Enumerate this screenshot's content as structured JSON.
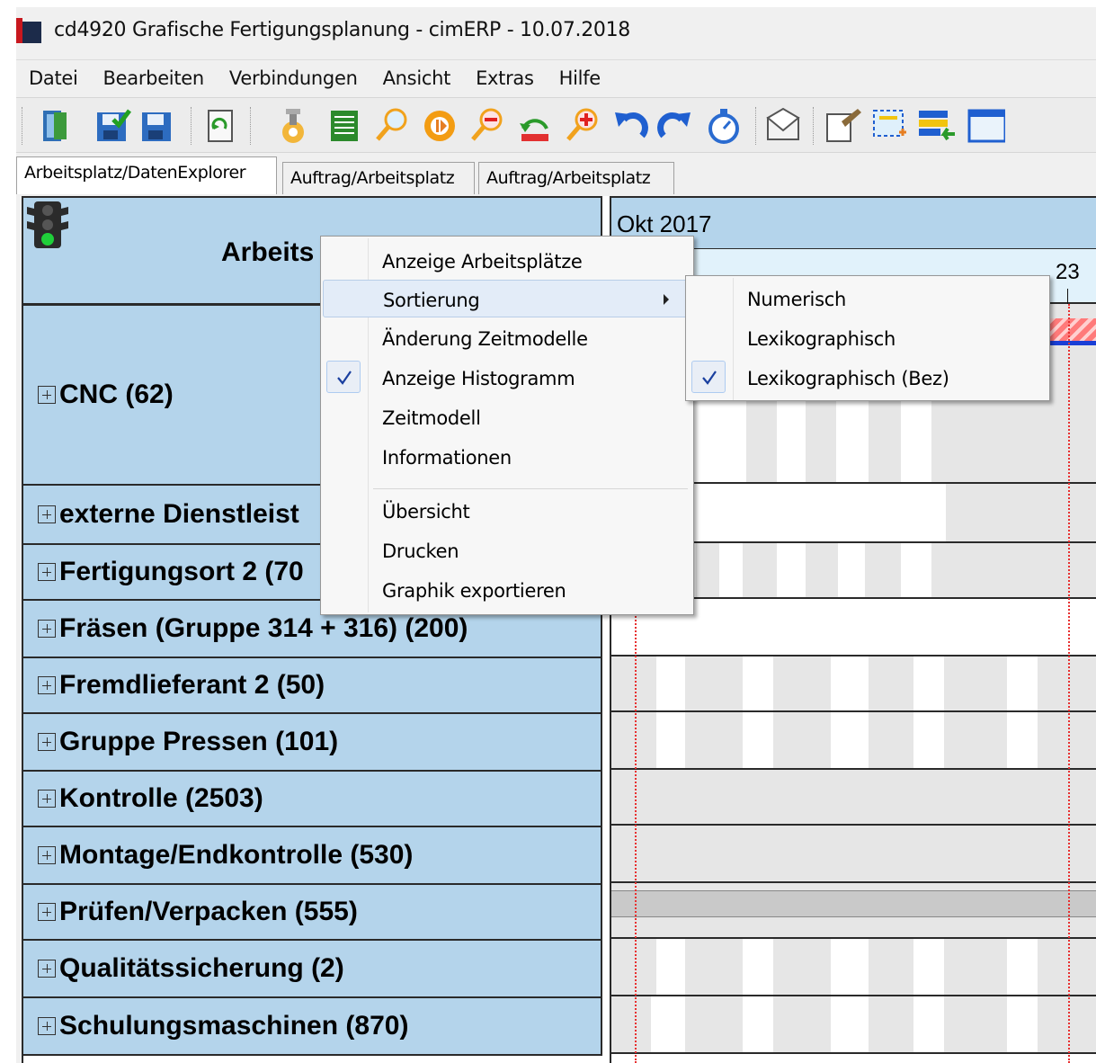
{
  "window": {
    "title": "cd4920 Grafische Fertigungsplanung - cimERP - 10.07.2018"
  },
  "menubar": [
    "Datei",
    "Bearbeiten",
    "Verbindungen",
    "Ansicht",
    "Extras",
    "Hilfe"
  ],
  "toolbar": {
    "icons": [
      "exit-icon",
      "save-green-icon",
      "save-icon",
      "refresh-icon",
      "settings-icon",
      "list-icon",
      "search-icon",
      "stop-icon",
      "zoom-out-icon",
      "undo-layout-icon",
      "zoom-in-icon",
      "undo-icon",
      "redo-icon",
      "timer-icon",
      "mail-icon",
      "edit-icon",
      "select-add-icon",
      "import-icon",
      "window-icon"
    ]
  },
  "tabs": [
    "Arbeitsplatz/DatenExplorer",
    "Auftrag/Arbeitsplatz",
    "Auftrag/Arbeitsplatz"
  ],
  "tree": {
    "header_title": "Arbeits",
    "rows": [
      "CNC (62)",
      "externe Dienstleist",
      "Fertigungsort 2 (70",
      "Fräsen (Gruppe 314 + 316) (200)",
      "Fremdlieferant 2 (50)",
      "Gruppe Pressen (101)",
      "Kontrolle (2503)",
      "Montage/Endkontrolle (530)",
      "Prüfen/Verpacken (555)",
      "Qualitätssicherung (2)",
      "Schulungsmaschinen (870)"
    ]
  },
  "gantt": {
    "month": "Okt 2017",
    "day": "23"
  },
  "context_menu": {
    "items": [
      {
        "label": "Anzeige Arbeitsplätze",
        "checked": false
      },
      {
        "label": "Sortierung",
        "checked": false,
        "submenu": true
      },
      {
        "label": "Änderung Zeitmodelle",
        "checked": false
      },
      {
        "label": "Anzeige Histogramm",
        "checked": true
      },
      {
        "label": "Zeitmodell",
        "checked": false
      },
      {
        "label": "Informationen",
        "checked": false
      },
      {
        "label": "Übersicht",
        "checked": false
      },
      {
        "label": "Drucken",
        "checked": false
      },
      {
        "label": "Graphik exportieren",
        "checked": false
      }
    ]
  },
  "submenu": {
    "items": [
      {
        "label": "Numerisch",
        "checked": false
      },
      {
        "label": "Lexikographisch",
        "checked": false
      },
      {
        "label": "Lexikographisch (Bez)",
        "checked": true
      }
    ]
  }
}
